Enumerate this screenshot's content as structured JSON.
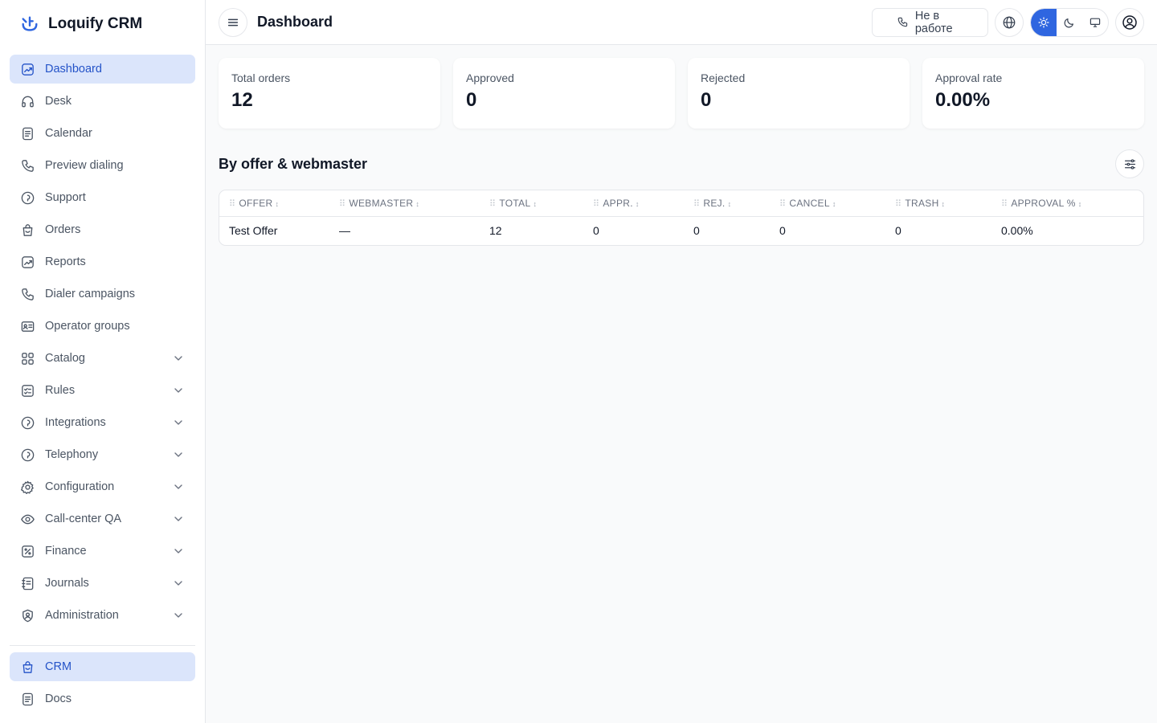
{
  "app": {
    "name": "Loquify CRM"
  },
  "sidebar": {
    "items": [
      {
        "label": "Dashboard",
        "icon": "chart-icon",
        "active": true,
        "expandable": false
      },
      {
        "label": "Desk",
        "icon": "headphones-icon",
        "active": false,
        "expandable": false
      },
      {
        "label": "Calendar",
        "icon": "document-icon",
        "active": false,
        "expandable": false
      },
      {
        "label": "Preview dialing",
        "icon": "phone-icon",
        "active": false,
        "expandable": false
      },
      {
        "label": "Support",
        "icon": "lifebuoy-icon",
        "active": false,
        "expandable": false
      },
      {
        "label": "Orders",
        "icon": "bag-icon",
        "active": false,
        "expandable": false
      },
      {
        "label": "Reports",
        "icon": "chart-icon",
        "active": false,
        "expandable": false
      },
      {
        "label": "Dialer campaigns",
        "icon": "phone-icon",
        "active": false,
        "expandable": false
      },
      {
        "label": "Operator groups",
        "icon": "id-card-icon",
        "active": false,
        "expandable": false
      },
      {
        "label": "Catalog",
        "icon": "grid-icon",
        "active": false,
        "expandable": true
      },
      {
        "label": "Rules",
        "icon": "checklist-icon",
        "active": false,
        "expandable": true
      },
      {
        "label": "Integrations",
        "icon": "lifebuoy-icon",
        "active": false,
        "expandable": true
      },
      {
        "label": "Telephony",
        "icon": "lifebuoy-icon",
        "active": false,
        "expandable": true
      },
      {
        "label": "Configuration",
        "icon": "gear-icon",
        "active": false,
        "expandable": true
      },
      {
        "label": "Call-center QA",
        "icon": "eye-icon",
        "active": false,
        "expandable": true
      },
      {
        "label": "Finance",
        "icon": "percent-icon",
        "active": false,
        "expandable": true
      },
      {
        "label": "Journals",
        "icon": "notebook-icon",
        "active": false,
        "expandable": true
      },
      {
        "label": "Administration",
        "icon": "user-shield-icon",
        "active": false,
        "expandable": true
      }
    ],
    "bottom_items": [
      {
        "label": "CRM",
        "icon": "bag-icon",
        "active": true
      },
      {
        "label": "Docs",
        "icon": "document-icon",
        "active": false
      }
    ]
  },
  "header": {
    "title": "Dashboard",
    "status_label": "Не в работе"
  },
  "stats": [
    {
      "label": "Total orders",
      "value": "12"
    },
    {
      "label": "Approved",
      "value": "0"
    },
    {
      "label": "Rejected",
      "value": "0"
    },
    {
      "label": "Approval rate",
      "value": "0.00%"
    }
  ],
  "section": {
    "title": "By offer & webmaster"
  },
  "table": {
    "columns": [
      "OFFER",
      "WEBMASTER",
      "TOTAL",
      "APPR.",
      "REJ.",
      "CANCEL",
      "TRASH",
      "APPROVAL %"
    ],
    "rows": [
      [
        "Test Offer",
        "—",
        "12",
        "0",
        "0",
        "0",
        "0",
        "0.00%"
      ]
    ]
  },
  "colors": {
    "accent": "#2f66e0",
    "active_bg": "#dbe5fb",
    "active_text": "#2453c8"
  }
}
